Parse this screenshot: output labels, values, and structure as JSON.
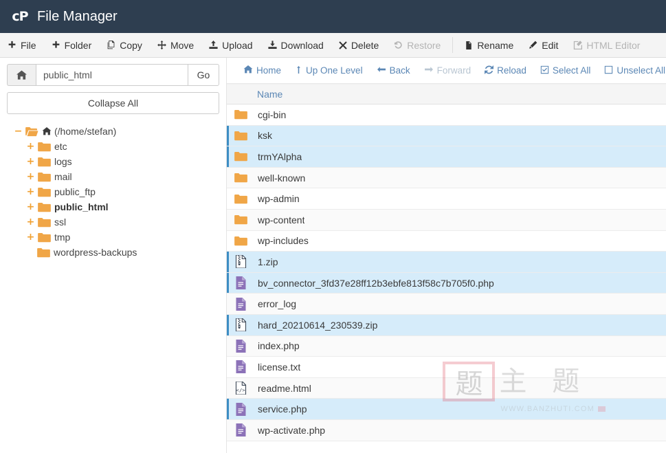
{
  "header": {
    "logo": "cp-logo",
    "title": "File Manager"
  },
  "action_toolbar": {
    "groups": [
      [
        {
          "label": "File",
          "icon": "plus-icon",
          "disabled": false
        },
        {
          "label": "Folder",
          "icon": "plus-icon",
          "disabled": false
        },
        {
          "label": "Copy",
          "icon": "copy-icon",
          "disabled": false
        },
        {
          "label": "Move",
          "icon": "move-icon",
          "disabled": false
        },
        {
          "label": "Upload",
          "icon": "upload-icon",
          "disabled": false
        },
        {
          "label": "Download",
          "icon": "download-icon",
          "disabled": false
        },
        {
          "label": "Delete",
          "icon": "cross-icon",
          "disabled": false
        },
        {
          "label": "Restore",
          "icon": "restore-icon",
          "disabled": true
        }
      ],
      [
        {
          "label": "Rename",
          "icon": "file-icon",
          "disabled": false
        },
        {
          "label": "Edit",
          "icon": "pencil-icon",
          "disabled": false
        },
        {
          "label": "HTML Editor",
          "icon": "html-editor-icon",
          "disabled": true
        }
      ]
    ]
  },
  "sidebar": {
    "home_icon": "home-icon",
    "path_value": "public_html",
    "path_placeholder": "public_html",
    "go_label": "Go",
    "collapse_all_label": "Collapse All",
    "tree": [
      {
        "label": "(/home/stefan)",
        "toggle": "−",
        "level": "root",
        "icons": [
          "open-folder-icon",
          "home-icon"
        ],
        "bold": false
      },
      {
        "label": "etc",
        "toggle": "+",
        "level": "child",
        "icons": [
          "folder-icon"
        ],
        "bold": false
      },
      {
        "label": "logs",
        "toggle": "+",
        "level": "child",
        "icons": [
          "folder-icon"
        ],
        "bold": false
      },
      {
        "label": "mail",
        "toggle": "+",
        "level": "child",
        "icons": [
          "folder-icon"
        ],
        "bold": false
      },
      {
        "label": "public_ftp",
        "toggle": "+",
        "level": "child",
        "icons": [
          "folder-icon"
        ],
        "bold": false
      },
      {
        "label": "public_html",
        "toggle": "+",
        "level": "child",
        "icons": [
          "folder-icon"
        ],
        "bold": true
      },
      {
        "label": "ssl",
        "toggle": "+",
        "level": "child",
        "icons": [
          "folder-icon"
        ],
        "bold": false
      },
      {
        "label": "tmp",
        "toggle": "+",
        "level": "child",
        "icons": [
          "folder-icon"
        ],
        "bold": false
      },
      {
        "label": "wordpress-backups",
        "toggle": "",
        "level": "leaf",
        "icons": [
          "folder-icon"
        ],
        "bold": false
      }
    ]
  },
  "nav_toolbar": {
    "buttons": [
      {
        "label": "Home",
        "icon": "home-icon",
        "disabled": false
      },
      {
        "label": "Up One Level",
        "icon": "arrow-up-icon",
        "disabled": false
      },
      {
        "label": "Back",
        "icon": "arrow-left-icon",
        "disabled": false
      },
      {
        "label": "Forward",
        "icon": "arrow-right-icon",
        "disabled": true
      },
      {
        "label": "Reload",
        "icon": "reload-icon",
        "disabled": false
      },
      {
        "label": "Select All",
        "icon": "checked-box-icon",
        "disabled": false
      },
      {
        "label": "Unselect All",
        "icon": "empty-box-icon",
        "disabled": false
      }
    ]
  },
  "file_table": {
    "columns": [
      "Name"
    ],
    "rows": [
      {
        "name": "cgi-bin",
        "icon": "folder-icon",
        "selected": false
      },
      {
        "name": "ksk",
        "icon": "folder-icon",
        "selected": true
      },
      {
        "name": "trmYAlpha",
        "icon": "folder-icon",
        "selected": true
      },
      {
        "name": "well-known",
        "icon": "folder-icon",
        "selected": false
      },
      {
        "name": "wp-admin",
        "icon": "folder-icon",
        "selected": false
      },
      {
        "name": "wp-content",
        "icon": "folder-icon",
        "selected": false
      },
      {
        "name": "wp-includes",
        "icon": "folder-icon",
        "selected": false
      },
      {
        "name": "1.zip",
        "icon": "zip-file-icon",
        "selected": true
      },
      {
        "name": "bv_connector_3fd37e28ff12b3ebfe813f58c7b705f0.php",
        "icon": "php-file-icon",
        "selected": true
      },
      {
        "name": "error_log",
        "icon": "php-file-icon",
        "selected": false
      },
      {
        "name": "hard_20210614_230539.zip",
        "icon": "zip-file-icon",
        "selected": true
      },
      {
        "name": "index.php",
        "icon": "php-file-icon",
        "selected": false
      },
      {
        "name": "license.txt",
        "icon": "php-file-icon",
        "selected": false
      },
      {
        "name": "readme.html",
        "icon": "html-file-icon",
        "selected": false
      },
      {
        "name": "service.php",
        "icon": "php-file-icon",
        "selected": true
      },
      {
        "name": "wp-activate.php",
        "icon": "php-file-icon",
        "selected": false
      }
    ]
  },
  "watermark": {
    "seal_char": "题",
    "text": "主  题",
    "url": "WWW.BANZHUTI.COM"
  },
  "colors": {
    "header_bg": "#2e3e50",
    "folder": "#f0a647",
    "php_icon": "#8c72b8",
    "link": "#5b87b5",
    "selected_row": "#d6ecfa",
    "selected_bar": "#3d8dc4"
  }
}
